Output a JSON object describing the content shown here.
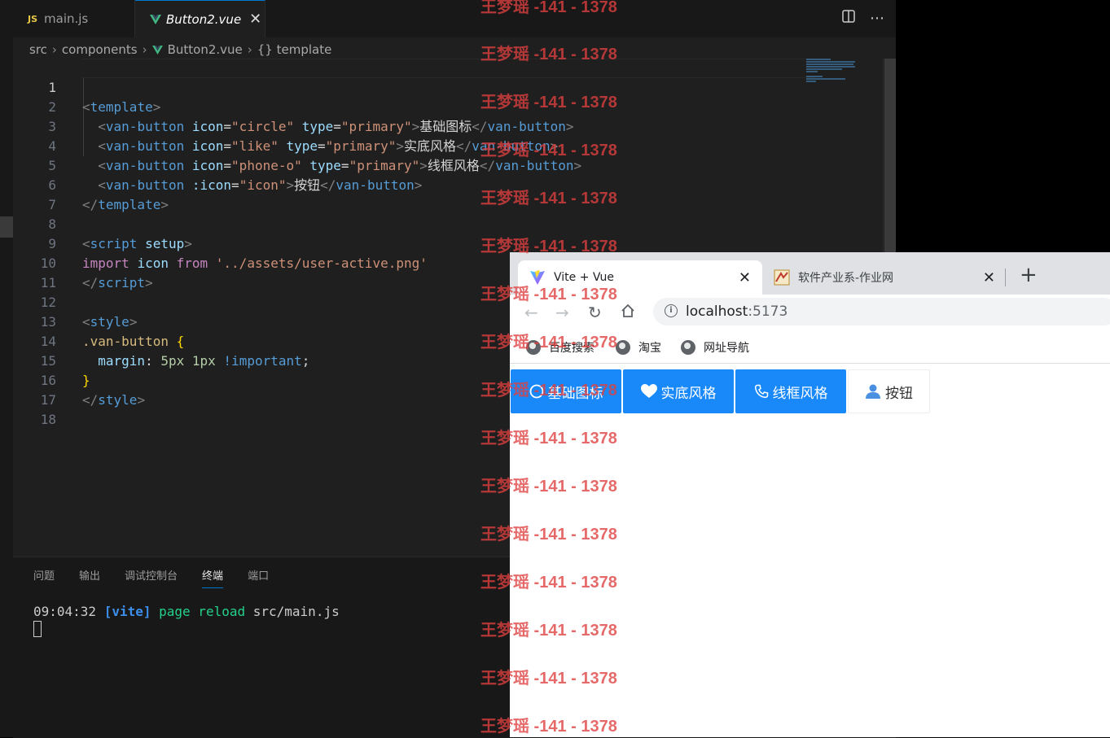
{
  "vscode": {
    "tabs": [
      {
        "badge": "JS",
        "label": "main.js"
      },
      {
        "label": "Button2.vue",
        "close": "✕"
      }
    ],
    "breadcrumb": [
      "src",
      "components",
      "Button2.vue",
      "{} template"
    ],
    "code_lines": [
      "1",
      "2",
      "3",
      "4",
      "5",
      "6",
      "7",
      "8",
      "9",
      "10",
      "11",
      "12",
      "13",
      "14",
      "15",
      "16",
      "17",
      "18"
    ],
    "code": {
      "l1": {
        "open": "<",
        "tag": "template",
        "close": ">"
      },
      "l2": {
        "tag": "van-button",
        "a1": "icon",
        "v1": "\"circle\"",
        "a2": "type",
        "v2": "\"primary\"",
        "text": "基础图标",
        "end": "van-button"
      },
      "l3": {
        "tag": "van-button",
        "a1": "icon",
        "v1": "\"like\"",
        "a2": "type",
        "v2": "\"primary\"",
        "text": "实底风格",
        "end": "van-button"
      },
      "l4": {
        "tag": "van-button",
        "a1": "icon",
        "v1": "\"phone-o\"",
        "a2": "type",
        "v2": "\"primary\"",
        "text": "线框风格",
        "end": "van-button"
      },
      "l5": {
        "tag": "van-button",
        "a1": ":icon",
        "v1": "\"icon\"",
        "text": "按钮",
        "end": "van-button"
      },
      "l6": {
        "tag": "template"
      },
      "l8": {
        "tag": "script",
        "attr": "setup"
      },
      "l9": {
        "kw1": "import",
        "id": "icon",
        "kw2": "from",
        "str": "'../assets/user-active.png'"
      },
      "l10": {
        "tag": "script"
      },
      "l12": {
        "tag": "style"
      },
      "l13": {
        "sel": ".van-button",
        "brace": "{"
      },
      "l14": {
        "prop": "margin",
        "val1": "5px",
        "val2": "1px",
        "imp": "!important"
      },
      "l15": {
        "brace": "}"
      },
      "l16": {
        "tag": "style"
      }
    },
    "panel": {
      "tabs": [
        "问题",
        "输出",
        "调试控制台",
        "终端",
        "端口"
      ],
      "active_tab": "终端",
      "terminal": {
        "time": "09:04:32",
        "tag": "[vite]",
        "msg": "page reload",
        "file": "src/main.js"
      }
    }
  },
  "browser": {
    "tabs": [
      {
        "title": "Vite + Vue",
        "close": "✕"
      },
      {
        "title": "软件产业系-作业网",
        "close": "✕"
      }
    ],
    "new_tab": "+",
    "url": {
      "host": "localhost",
      "port": ":5173"
    },
    "bookmarks": [
      "百度搜索",
      "淘宝",
      "网址导航"
    ],
    "buttons": [
      {
        "label": "基础图标",
        "icon": "circle-icon",
        "type": "primary"
      },
      {
        "label": "实底风格",
        "icon": "heart-icon",
        "type": "primary"
      },
      {
        "label": "线框风格",
        "icon": "phone-icon",
        "type": "primary"
      },
      {
        "label": "按钮",
        "icon": "user-icon",
        "type": "default"
      }
    ]
  },
  "watermark": {
    "text": "王梦瑶 -141 - 1378"
  },
  "colors": {
    "vue_primary": "#1989fa",
    "editor_bg": "#1f1f1f",
    "watermark": "#e04040"
  }
}
